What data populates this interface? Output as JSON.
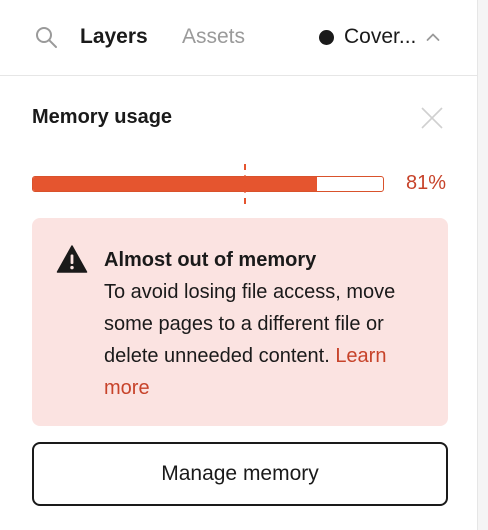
{
  "tabs": {
    "search_icon": "search-icon",
    "layers_label": "Layers",
    "assets_label": "Assets",
    "active": "Layers"
  },
  "page_selector": {
    "name": "Cover...",
    "dot_color": "#1a1a1a",
    "chevron_icon": "chevron-up-icon"
  },
  "memory": {
    "title": "Memory usage",
    "close_icon": "close-icon",
    "usage_percent": 81,
    "usage_label": "81%",
    "bar_color": "#e5552f",
    "text_color": "#c7432a"
  },
  "alert": {
    "icon": "warning-icon",
    "title": "Almost out of memory",
    "body": "To avoid losing file access, move some pages to a different file or delete unneeded content.",
    "link": "Learn more",
    "background": "#fbe3e1"
  },
  "actions": {
    "manage_label": "Manage memory"
  }
}
